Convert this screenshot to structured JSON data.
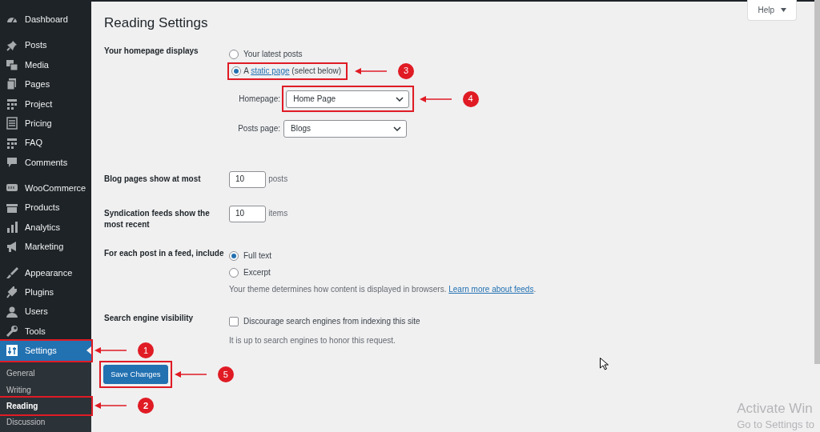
{
  "sidebar": {
    "groups": [
      {
        "items": [
          {
            "label": "Dashboard",
            "selected": false
          }
        ]
      },
      {
        "items": [
          {
            "label": "Posts",
            "selected": false
          },
          {
            "label": "Media",
            "selected": false
          },
          {
            "label": "Pages",
            "selected": false
          },
          {
            "label": "Project",
            "selected": false
          },
          {
            "label": "Pricing",
            "selected": false
          },
          {
            "label": "FAQ",
            "selected": false
          },
          {
            "label": "Comments",
            "selected": false
          }
        ]
      },
      {
        "items": [
          {
            "label": "WooCommerce",
            "selected": false
          },
          {
            "label": "Products",
            "selected": false
          },
          {
            "label": "Analytics",
            "selected": false
          },
          {
            "label": "Marketing",
            "selected": false
          }
        ]
      },
      {
        "items": [
          {
            "label": "Appearance",
            "selected": false
          },
          {
            "label": "Plugins",
            "selected": false
          },
          {
            "label": "Users",
            "selected": false
          },
          {
            "label": "Tools",
            "selected": false
          },
          {
            "label": "Settings",
            "selected": true,
            "callout": "1"
          }
        ]
      }
    ],
    "submenu": [
      {
        "label": "General",
        "selected": false
      },
      {
        "label": "Writing",
        "selected": false
      },
      {
        "label": "Reading",
        "selected": true,
        "callout": "2"
      },
      {
        "label": "Discussion",
        "selected": false
      }
    ]
  },
  "page_title": "Reading Settings",
  "help_button": "Help",
  "settings": [
    {
      "kind": "homepage",
      "label": "Your homepage displays",
      "options": [
        {
          "text": "Your latest posts",
          "selected": false
        },
        {
          "text": "A ",
          "link": "static page",
          "text_after": " (select below)",
          "selected": true,
          "callout": "3"
        }
      ],
      "selects": [
        {
          "label": "Homepage:",
          "value": "Home Page",
          "callout": "4"
        },
        {
          "label": "Posts page:",
          "value": "Blogs"
        }
      ]
    },
    {
      "kind": "number",
      "label": "Blog pages show at most",
      "value": "10",
      "unit": "posts"
    },
    {
      "kind": "number",
      "label": "Syndication feeds show the most recent",
      "value": "10",
      "unit": "items"
    },
    {
      "kind": "radio",
      "label": "For each post in a feed, include",
      "options": [
        {
          "text": "Full text",
          "selected": true
        },
        {
          "text": "Excerpt",
          "selected": false
        }
      ],
      "description": "Your theme determines how content is displayed in browsers. ",
      "description_link": "Learn more about feeds",
      "description_end": "."
    },
    {
      "kind": "checkbox",
      "label": "Search engine visibility",
      "option": "Discourage search engines from indexing this site",
      "checked": false,
      "description": "It is up to search engines to honor this request."
    }
  ],
  "save_button": {
    "label": "Save Changes",
    "callout": "5"
  },
  "os_notice": {
    "title": "Activate Win",
    "subtitle": "Go to Settings to"
  }
}
